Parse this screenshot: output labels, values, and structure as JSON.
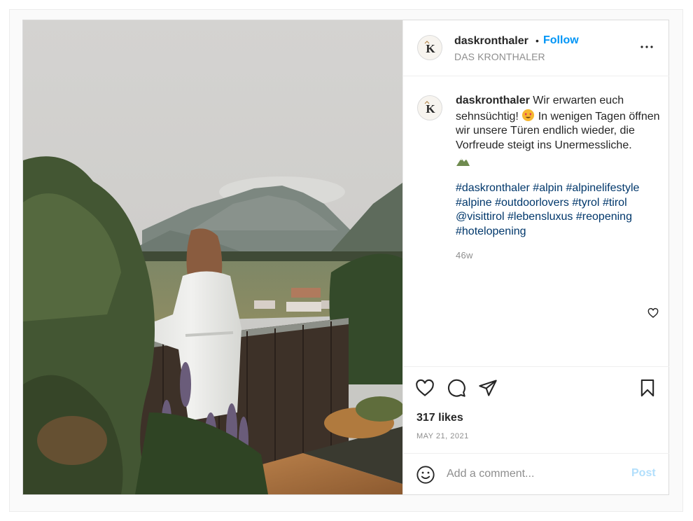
{
  "post": {
    "photo": {
      "icon": "post-photo-mountain-terrace"
    },
    "header": {
      "username": "daskronthaler",
      "separator": "•",
      "follow_label": "Follow",
      "subtitle": "DAS KRONTHALER",
      "more_icon": "more-options-icon"
    },
    "caption": {
      "username": "daskronthaler",
      "text_before_emoji": "Wir erwarten euch sehnsüchtig! ",
      "text_after_emoji": " In wenigen Tagen öffnen wir unsere Türen endlich wieder, die Vorfreude steigt ins Unermessliche.",
      "emoji_1": "heart-eyes-emoji",
      "emoji_2": "mountain-emoji",
      "hashtags": [
        "#daskronthaler",
        "#alpin",
        "#alpinelifestyle",
        "#alpine",
        "#outdoorlovers",
        "#tyrol",
        "#tirol",
        "@visittirol",
        "#lebensluxus",
        "#reopening",
        "#hotelopening"
      ],
      "age": "46w"
    },
    "actions": {
      "like_icon": "heart-icon",
      "comment_icon": "comment-icon",
      "share_icon": "share-icon",
      "save_icon": "bookmark-icon"
    },
    "likes": "317 likes",
    "date": "MAY 21, 2021",
    "comment": {
      "placeholder": "Add a comment...",
      "post_label": "Post",
      "emoji_icon": "smiley-icon"
    },
    "colors": {
      "link_blue": "#0095f6",
      "hashtag_blue": "#00376b",
      "post_disabled": "#b2dffc",
      "text_primary": "#262626",
      "text_secondary": "#8e8e8e"
    }
  }
}
